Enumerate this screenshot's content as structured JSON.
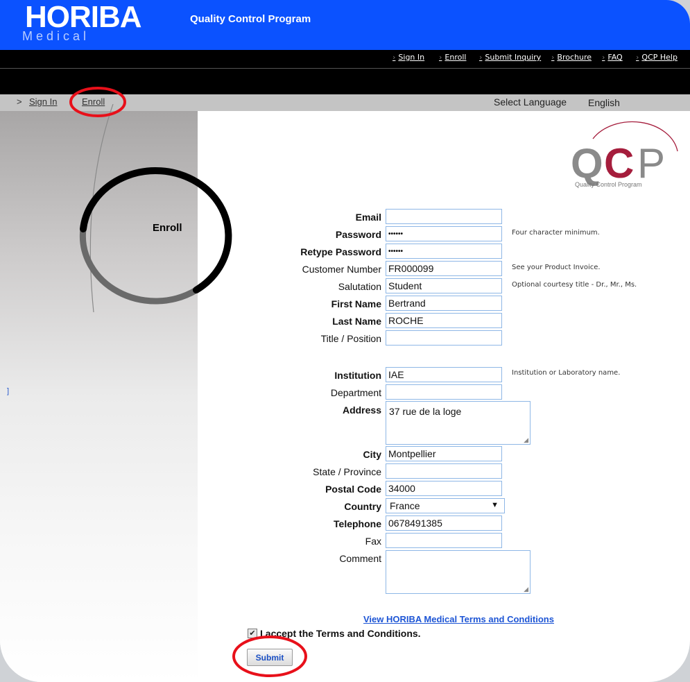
{
  "header": {
    "logo": "HORIBA",
    "logo_sub": "Medical",
    "app_title": "Quality Control Program"
  },
  "nav": {
    "links": [
      "Sign In",
      "Enroll",
      "Submit Inquiry",
      "Brochure",
      "FAQ",
      "QCP Help"
    ]
  },
  "breadcrumb": {
    "separator": ">",
    "items": [
      "Sign In",
      "Enroll"
    ]
  },
  "language": {
    "label": "Select Language",
    "value": "English"
  },
  "sidebar": {
    "title": "Enroll",
    "mark": "]"
  },
  "qcp_logo": {
    "letters": "QCP",
    "caption": "Quality Control Program"
  },
  "form": {
    "fields": [
      {
        "label": "Email",
        "value": ""
      },
      {
        "label": "Password",
        "value": "••••••"
      },
      {
        "label": "Retype Password",
        "value": "••••••"
      },
      {
        "label": "Customer Number",
        "value": "FR000099"
      },
      {
        "label": "Salutation",
        "value": "Student"
      },
      {
        "label": "First Name",
        "value": "Bertrand"
      },
      {
        "label": "Last Name",
        "value": "ROCHE"
      },
      {
        "label": "Title / Position",
        "value": ""
      },
      {
        "label": "Institution",
        "value": "IAE"
      },
      {
        "label": "Department",
        "value": ""
      },
      {
        "label": "Address",
        "value": "37 rue de la loge"
      },
      {
        "label": "City",
        "value": "Montpellier"
      },
      {
        "label": "State / Province",
        "value": ""
      },
      {
        "label": "Postal Code",
        "value": "34000"
      },
      {
        "label": "Country",
        "value": "France"
      },
      {
        "label": "Telephone",
        "value": "0678491385"
      },
      {
        "label": "Fax",
        "value": ""
      },
      {
        "label": "Comment",
        "value": ""
      }
    ],
    "hints": {
      "password": "Four character minimum.",
      "customer_number": "See your Product Invoice.",
      "salutation": "Optional courtesy title - Dr., Mr., Ms.",
      "institution": "Institution or Laboratory name."
    },
    "terms_link": "View HORIBA Medical Terms and Conditions",
    "accept_label": "I accept the Terms and Conditions.",
    "accept_checked": true,
    "submit_label": "Submit"
  },
  "colors": {
    "header_blue": "#0b52ff",
    "nav_black": "#000000",
    "annotation_red": "#e8101a",
    "field_border": "#8eb7e6",
    "link_blue": "#1d55d5",
    "qcp_red": "#a51d3c"
  }
}
